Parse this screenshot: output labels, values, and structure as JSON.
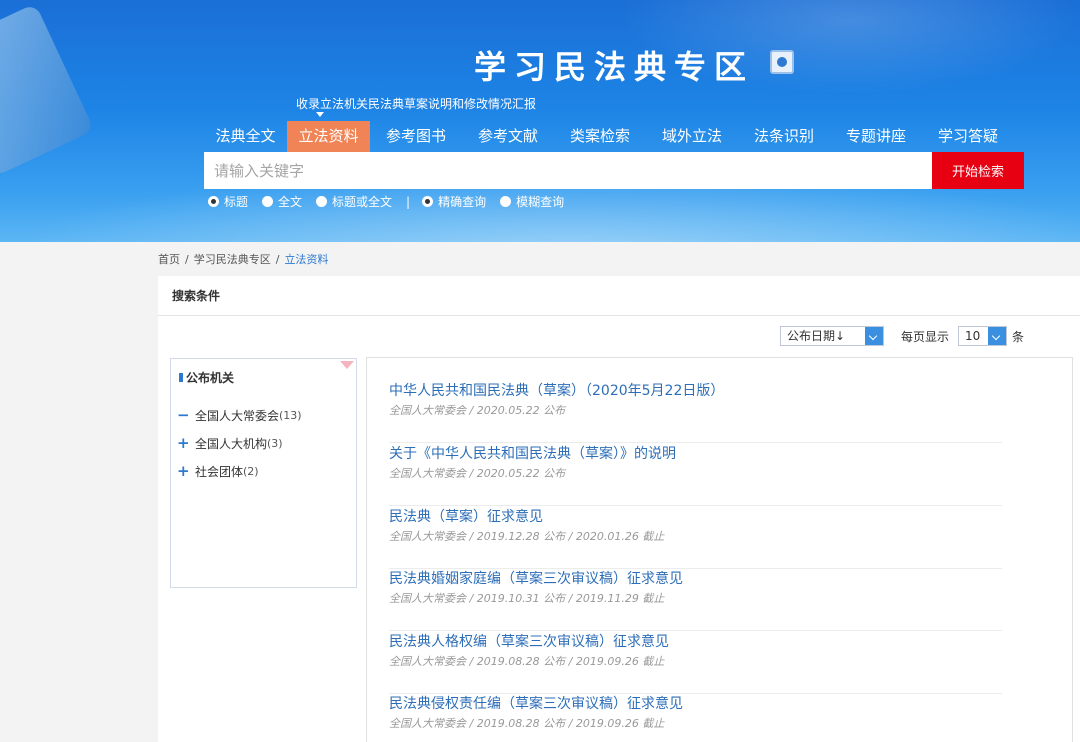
{
  "header": {
    "title": "学习民法典专区",
    "tooltip": "收录立法机关民法典草案说明和修改情况汇报"
  },
  "nav": {
    "items": [
      {
        "label": "法典全文",
        "active": false
      },
      {
        "label": "立法资料",
        "active": true
      },
      {
        "label": "参考图书",
        "active": false
      },
      {
        "label": "参考文献",
        "active": false
      },
      {
        "label": "类案检索",
        "active": false
      },
      {
        "label": "域外立法",
        "active": false
      },
      {
        "label": "法条识别",
        "active": false
      },
      {
        "label": "专题讲座",
        "active": false
      },
      {
        "label": "学习答疑",
        "active": false
      }
    ]
  },
  "search": {
    "placeholder": "请输入关键字",
    "button_label": "开始检索",
    "scope_options": [
      {
        "label": "标题",
        "checked": true
      },
      {
        "label": "全文",
        "checked": false
      },
      {
        "label": "标题或全文",
        "checked": false
      }
    ],
    "separator": "|",
    "mode_options": [
      {
        "label": "精确查询",
        "checked": true
      },
      {
        "label": "模糊查询",
        "checked": false
      }
    ]
  },
  "breadcrumb": {
    "items": [
      "首页",
      "学习民法典专区",
      "立法资料"
    ],
    "separator": "/"
  },
  "panel": {
    "heading": "搜索条件"
  },
  "sort": {
    "selected": "公布日期↓",
    "per_page_label": "每页显示",
    "per_page_value": "10",
    "unit": "条"
  },
  "filter": {
    "title": "公布机关",
    "items": [
      {
        "toggle": "−",
        "label": "全国人大常委会",
        "count": "(13)"
      },
      {
        "toggle": "+",
        "label": "全国人大机构",
        "count": "(3)"
      },
      {
        "toggle": "+",
        "label": "社会团体",
        "count": "(2)"
      }
    ]
  },
  "results": [
    {
      "title": "中华人民共和国民法典（草案）（2020年5月22日版）",
      "meta": "全国人大常委会 / 2020.05.22 公布"
    },
    {
      "title": "关于《中华人民共和国民法典（草案）》的说明",
      "meta": "全国人大常委会 / 2020.05.22 公布"
    },
    {
      "title": "民法典（草案）征求意见",
      "meta": "全国人大常委会 / 2019.12.28 公布 / 2020.01.26 截止"
    },
    {
      "title": "民法典婚姻家庭编（草案三次审议稿）征求意见",
      "meta": "全国人大常委会 / 2019.10.31 公布 / 2019.11.29 截止"
    },
    {
      "title": "民法典人格权编（草案三次审议稿）征求意见",
      "meta": "全国人大常委会 / 2019.08.28 公布 / 2019.09.26 截止"
    },
    {
      "title": "民法典侵权责任编（草案三次审议稿）征求意见",
      "meta": "全国人大常委会 / 2019.08.28 公布 / 2019.09.26 截止"
    }
  ],
  "colors": {
    "accent": "#2d79cf",
    "nav_active": "#f18456",
    "search_button": "#e60012"
  }
}
